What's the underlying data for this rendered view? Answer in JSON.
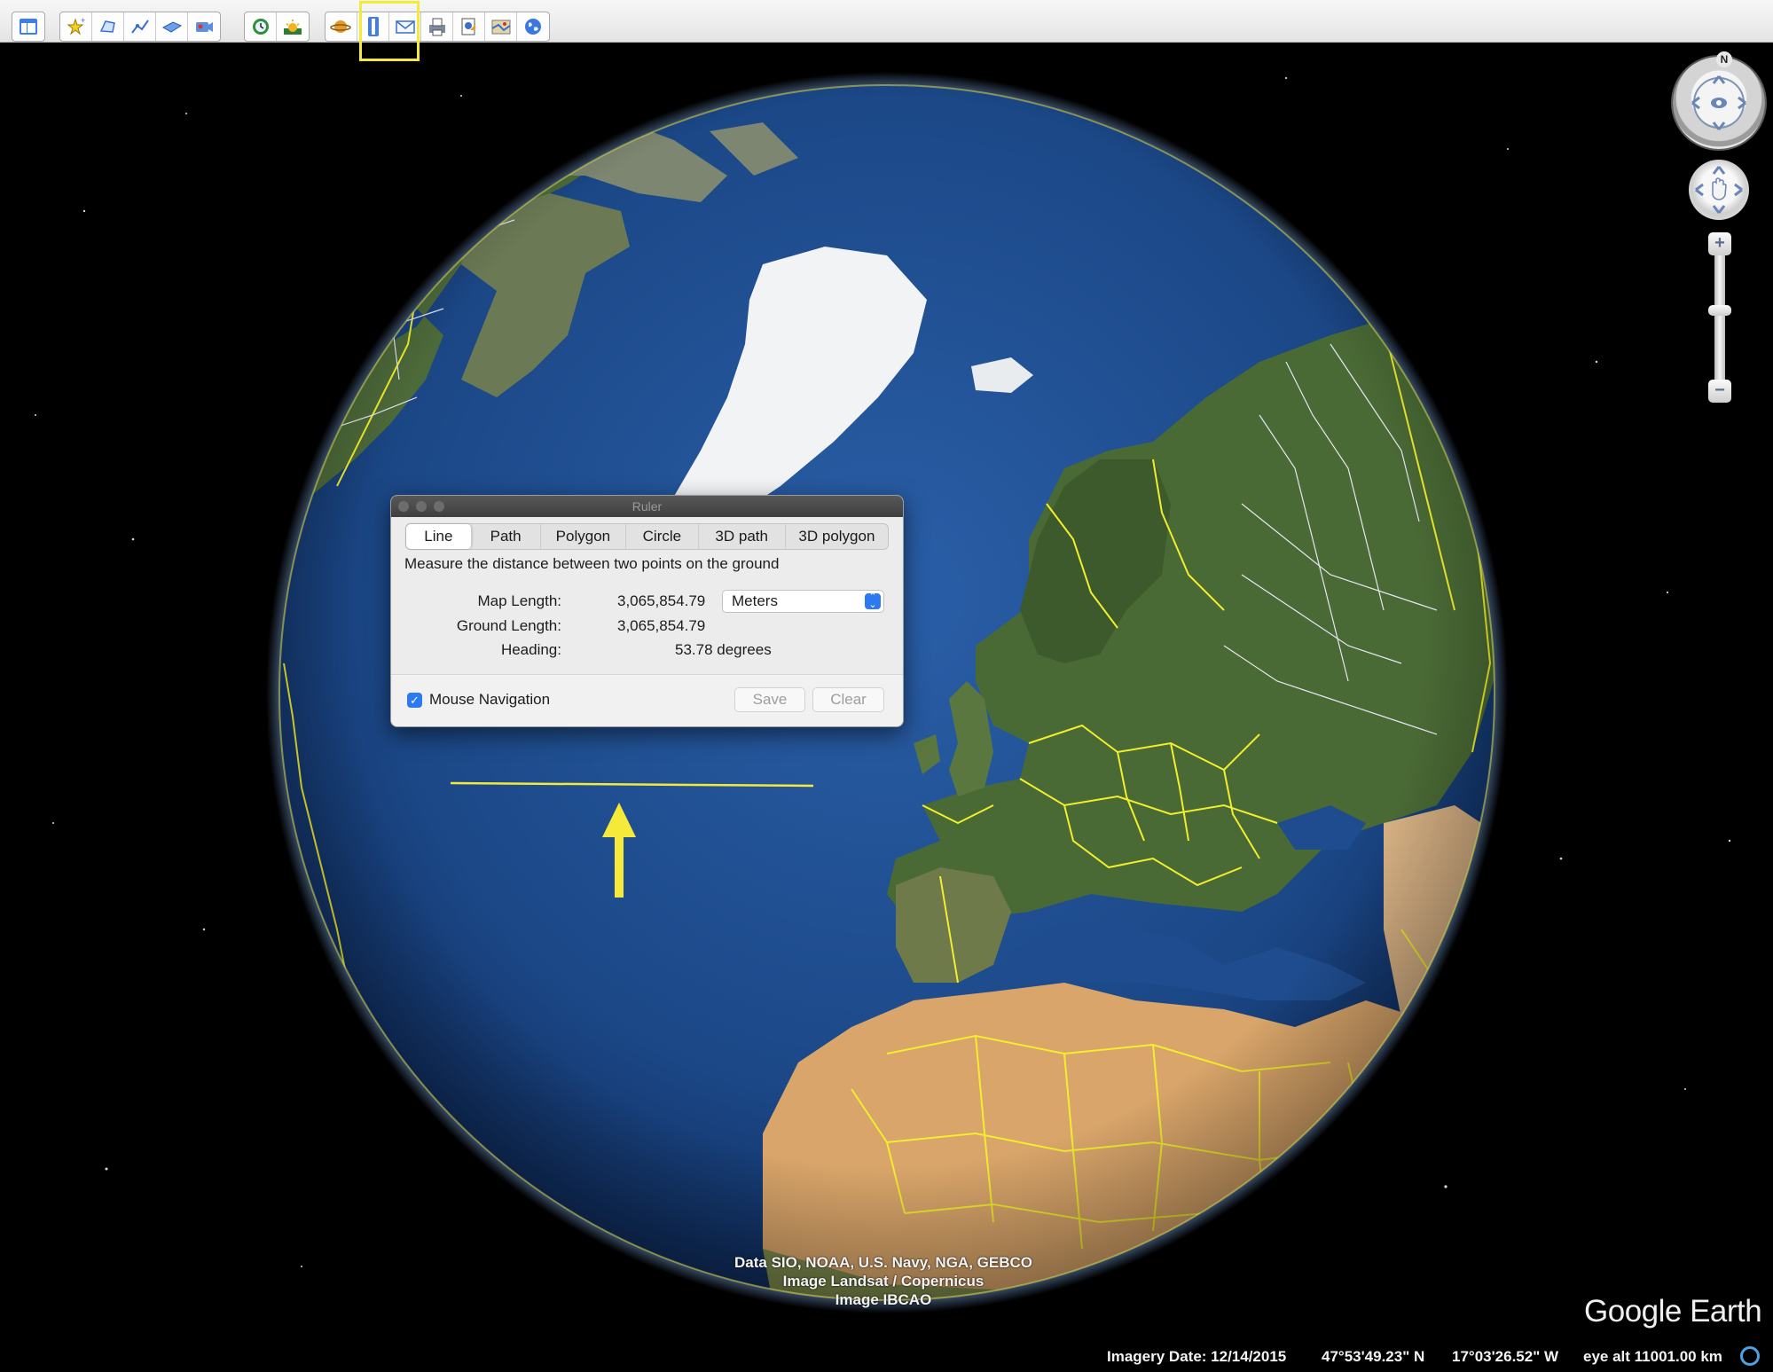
{
  "toolbar": {
    "buttons": [
      {
        "name": "sidebar-toggle-icon",
        "color": "#3f7ee8"
      },
      {
        "name": "add-placemark-icon"
      },
      {
        "name": "add-polygon-icon"
      },
      {
        "name": "add-path-icon"
      },
      {
        "name": "add-image-overlay-icon"
      },
      {
        "name": "record-tour-icon"
      },
      {
        "name": "historical-imagery-icon"
      },
      {
        "name": "sunlight-icon"
      },
      {
        "name": "switch-planet-icon"
      },
      {
        "name": "ruler-icon"
      },
      {
        "name": "email-icon"
      },
      {
        "name": "print-icon"
      },
      {
        "name": "save-image-icon"
      },
      {
        "name": "view-in-maps-icon"
      },
      {
        "name": "earth-globe-icon"
      }
    ],
    "highlight_color": "#f5e93a"
  },
  "ruler": {
    "title": "Ruler",
    "tabs": [
      "Line",
      "Path",
      "Polygon",
      "Circle",
      "3D path",
      "3D polygon"
    ],
    "active_tab": "Line",
    "description": "Measure the distance between two points on the ground",
    "map_length_label": "Map Length:",
    "map_length_value": "3,065,854.79",
    "units": "Meters",
    "ground_length_label": "Ground Length:",
    "ground_length_value": "3,065,854.79",
    "heading_label": "Heading:",
    "heading_value": "53.78 degrees",
    "mouse_navigation_label": "Mouse Navigation",
    "mouse_navigation_checked": true,
    "save_label": "Save",
    "clear_label": "Clear"
  },
  "navigation": {
    "compass_north": "N",
    "zoom_in": "+",
    "zoom_out": "−"
  },
  "attribution": {
    "line1": "Data SIO, NOAA, U.S. Navy, NGA, GEBCO",
    "line2": "Image Landsat / Copernicus",
    "line3": "Image IBCAO"
  },
  "logo": "Google Earth",
  "status_bar": {
    "imagery_date": "Imagery Date: 12/14/2015",
    "latitude": "47°53'49.23\" N",
    "longitude": "17°03'26.52\" W",
    "eye_alt": "eye alt 11001.00 km"
  },
  "colors": {
    "border_lines": "#f2ee2e",
    "ocean": "#1d4a8e",
    "land": "#4a6a35",
    "desert": "#d9a56a",
    "ice": "#f2f4f6",
    "accent": "#2d79f2"
  }
}
